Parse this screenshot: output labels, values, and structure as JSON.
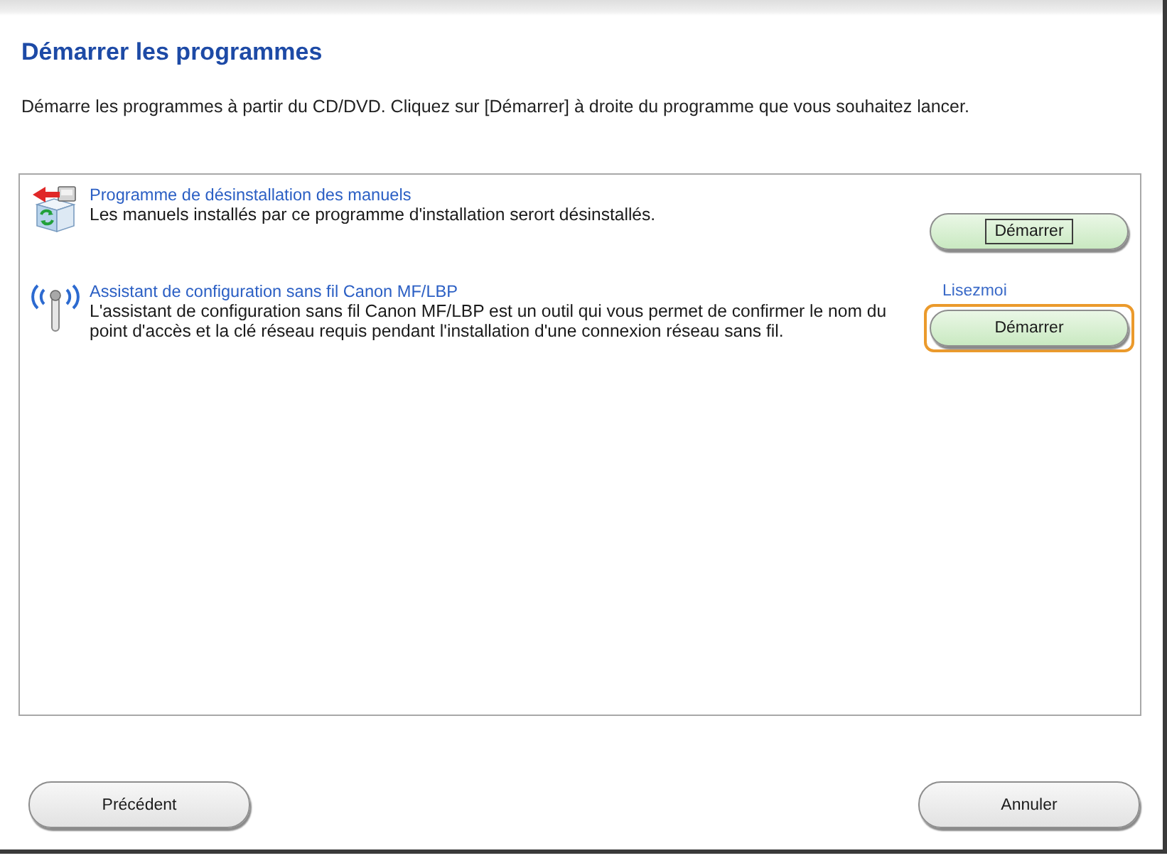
{
  "window": {
    "title": "Démarrer les programmes",
    "instruction": "Démarre les programmes à partir du CD/DVD. Cliquez sur [Démarrer] à droite du programme que vous souhaitez lancer."
  },
  "programs": [
    {
      "kind": "uninstall",
      "title": "Programme de désinstallation des manuels",
      "description": "Les manuels installés par ce programme d'installation serort désinstallés.",
      "button": "Démarrer",
      "focused": true,
      "highlighted": false
    },
    {
      "kind": "wireless",
      "title": "Assistant de configuration sans fil Canon MF/LBP",
      "description": "L'assistant de configuration sans fil Canon MF/LBP est un outil qui vous permet de confirmer le nom du point d'accès et la clé réseau requis pendant l'installation d'une connexion réseau sans fil.",
      "readme": "Lisezmoi",
      "button": "Démarrer",
      "focused": false,
      "highlighted": true
    }
  ],
  "buttons": [
    {
      "kind": "back",
      "label": "Précédent"
    },
    {
      "kind": "cancel",
      "label": "Annuler"
    }
  ]
}
